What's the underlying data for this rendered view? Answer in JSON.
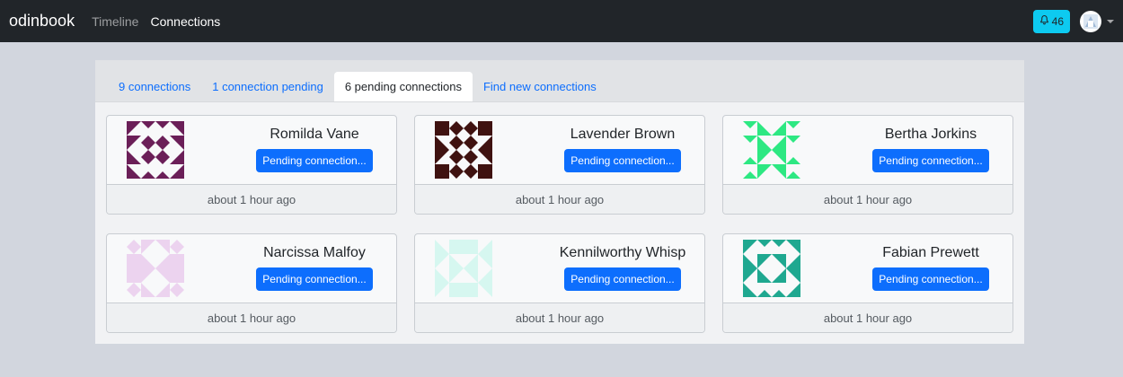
{
  "navbar": {
    "brand": "odinbook",
    "links": [
      {
        "label": "Timeline",
        "active": false
      },
      {
        "label": "Connections",
        "active": true
      }
    ],
    "notifications": {
      "icon": "bell-icon",
      "count": "46",
      "color": "#0dcaf0"
    },
    "avatar_icon": "user-avatar-icon"
  },
  "tabs": [
    {
      "label": "9 connections",
      "active": false
    },
    {
      "label": "1 connection pending",
      "active": false
    },
    {
      "label": "6 pending connections",
      "active": true
    },
    {
      "label": "Find new connections",
      "active": false
    }
  ],
  "cards": [
    {
      "name": "Romilda Vane",
      "button": "Pending connection...",
      "time": "about 1 hour ago",
      "color": "#6b1f58"
    },
    {
      "name": "Lavender Brown",
      "button": "Pending connection...",
      "time": "about 1 hour ago",
      "color": "#3f1210"
    },
    {
      "name": "Bertha Jorkins",
      "button": "Pending connection...",
      "time": "about 1 hour ago",
      "color": "#2de882"
    },
    {
      "name": "Narcissa Malfoy",
      "button": "Pending connection...",
      "time": "about 1 hour ago",
      "color": "#ecd3ef"
    },
    {
      "name": "Kennilworthy Whisp",
      "button": "Pending connection...",
      "time": "about 1 hour ago",
      "color": "#d6f7f0"
    },
    {
      "name": "Fabian Prewett",
      "button": "Pending connection...",
      "time": "about 1 hour ago",
      "color": "#1fa890"
    }
  ],
  "colors": {
    "primary": "#0d6efd",
    "navbar": "#212529",
    "background": "#d2d6de"
  }
}
